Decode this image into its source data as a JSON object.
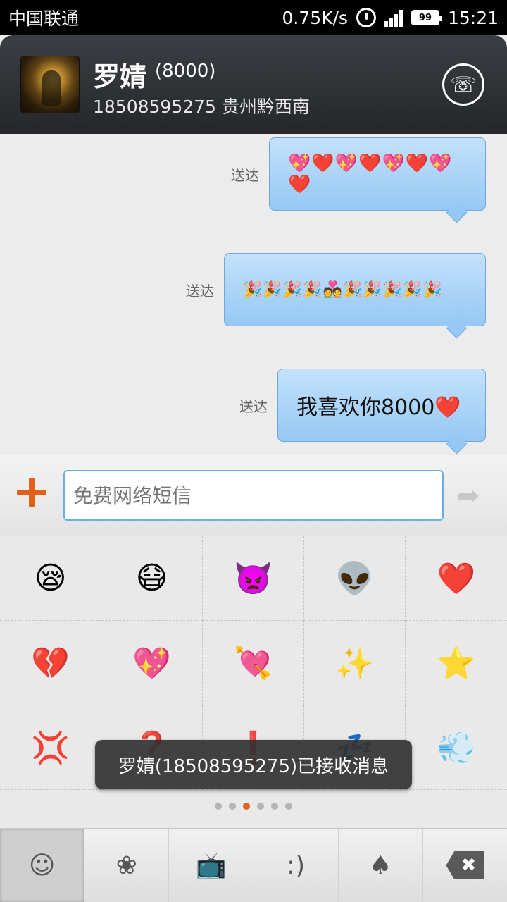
{
  "status_bar": {
    "carrier": "中国联通",
    "net_speed": "0.75K/s",
    "battery": "99",
    "time": "15:21"
  },
  "header": {
    "name": "罗婧",
    "tag": "(8000)",
    "subtitle": "18508595275 贵州黔西南",
    "call_icon": "☏"
  },
  "messages": [
    {
      "status": "送达",
      "text": "💖❤️💖❤️💖❤️💖❤️"
    },
    {
      "status": "送达",
      "text": "🎉🎉🎉🎉💑🎉🎉🎉🎉🎉"
    },
    {
      "status": "送达",
      "text": "我喜欢你8000❤️"
    }
  ],
  "input": {
    "placeholder": "免费网络短信",
    "add_icon": "plus-icon",
    "send_icon": "➦"
  },
  "emoji_grid": [
    "😪",
    "😷",
    "👿",
    "👽",
    "❤️",
    "💔",
    "💖",
    "💘",
    "✨",
    "⭐",
    "💢",
    "❓",
    "❗",
    "💤",
    "💨"
  ],
  "pager": {
    "pages": 6,
    "active": 3
  },
  "toast": "罗婧(18508595275)已接收消息",
  "bottom_tabs": [
    {
      "icon": "☺"
    },
    {
      "icon": "❀"
    },
    {
      "icon": "📺"
    },
    {
      "icon": ":)"
    },
    {
      "icon": "♠"
    },
    {
      "icon": "✖"
    }
  ],
  "colors": {
    "accent": "#e2611c",
    "bubble": "#a9d2f6",
    "input_border": "#67aee6"
  }
}
